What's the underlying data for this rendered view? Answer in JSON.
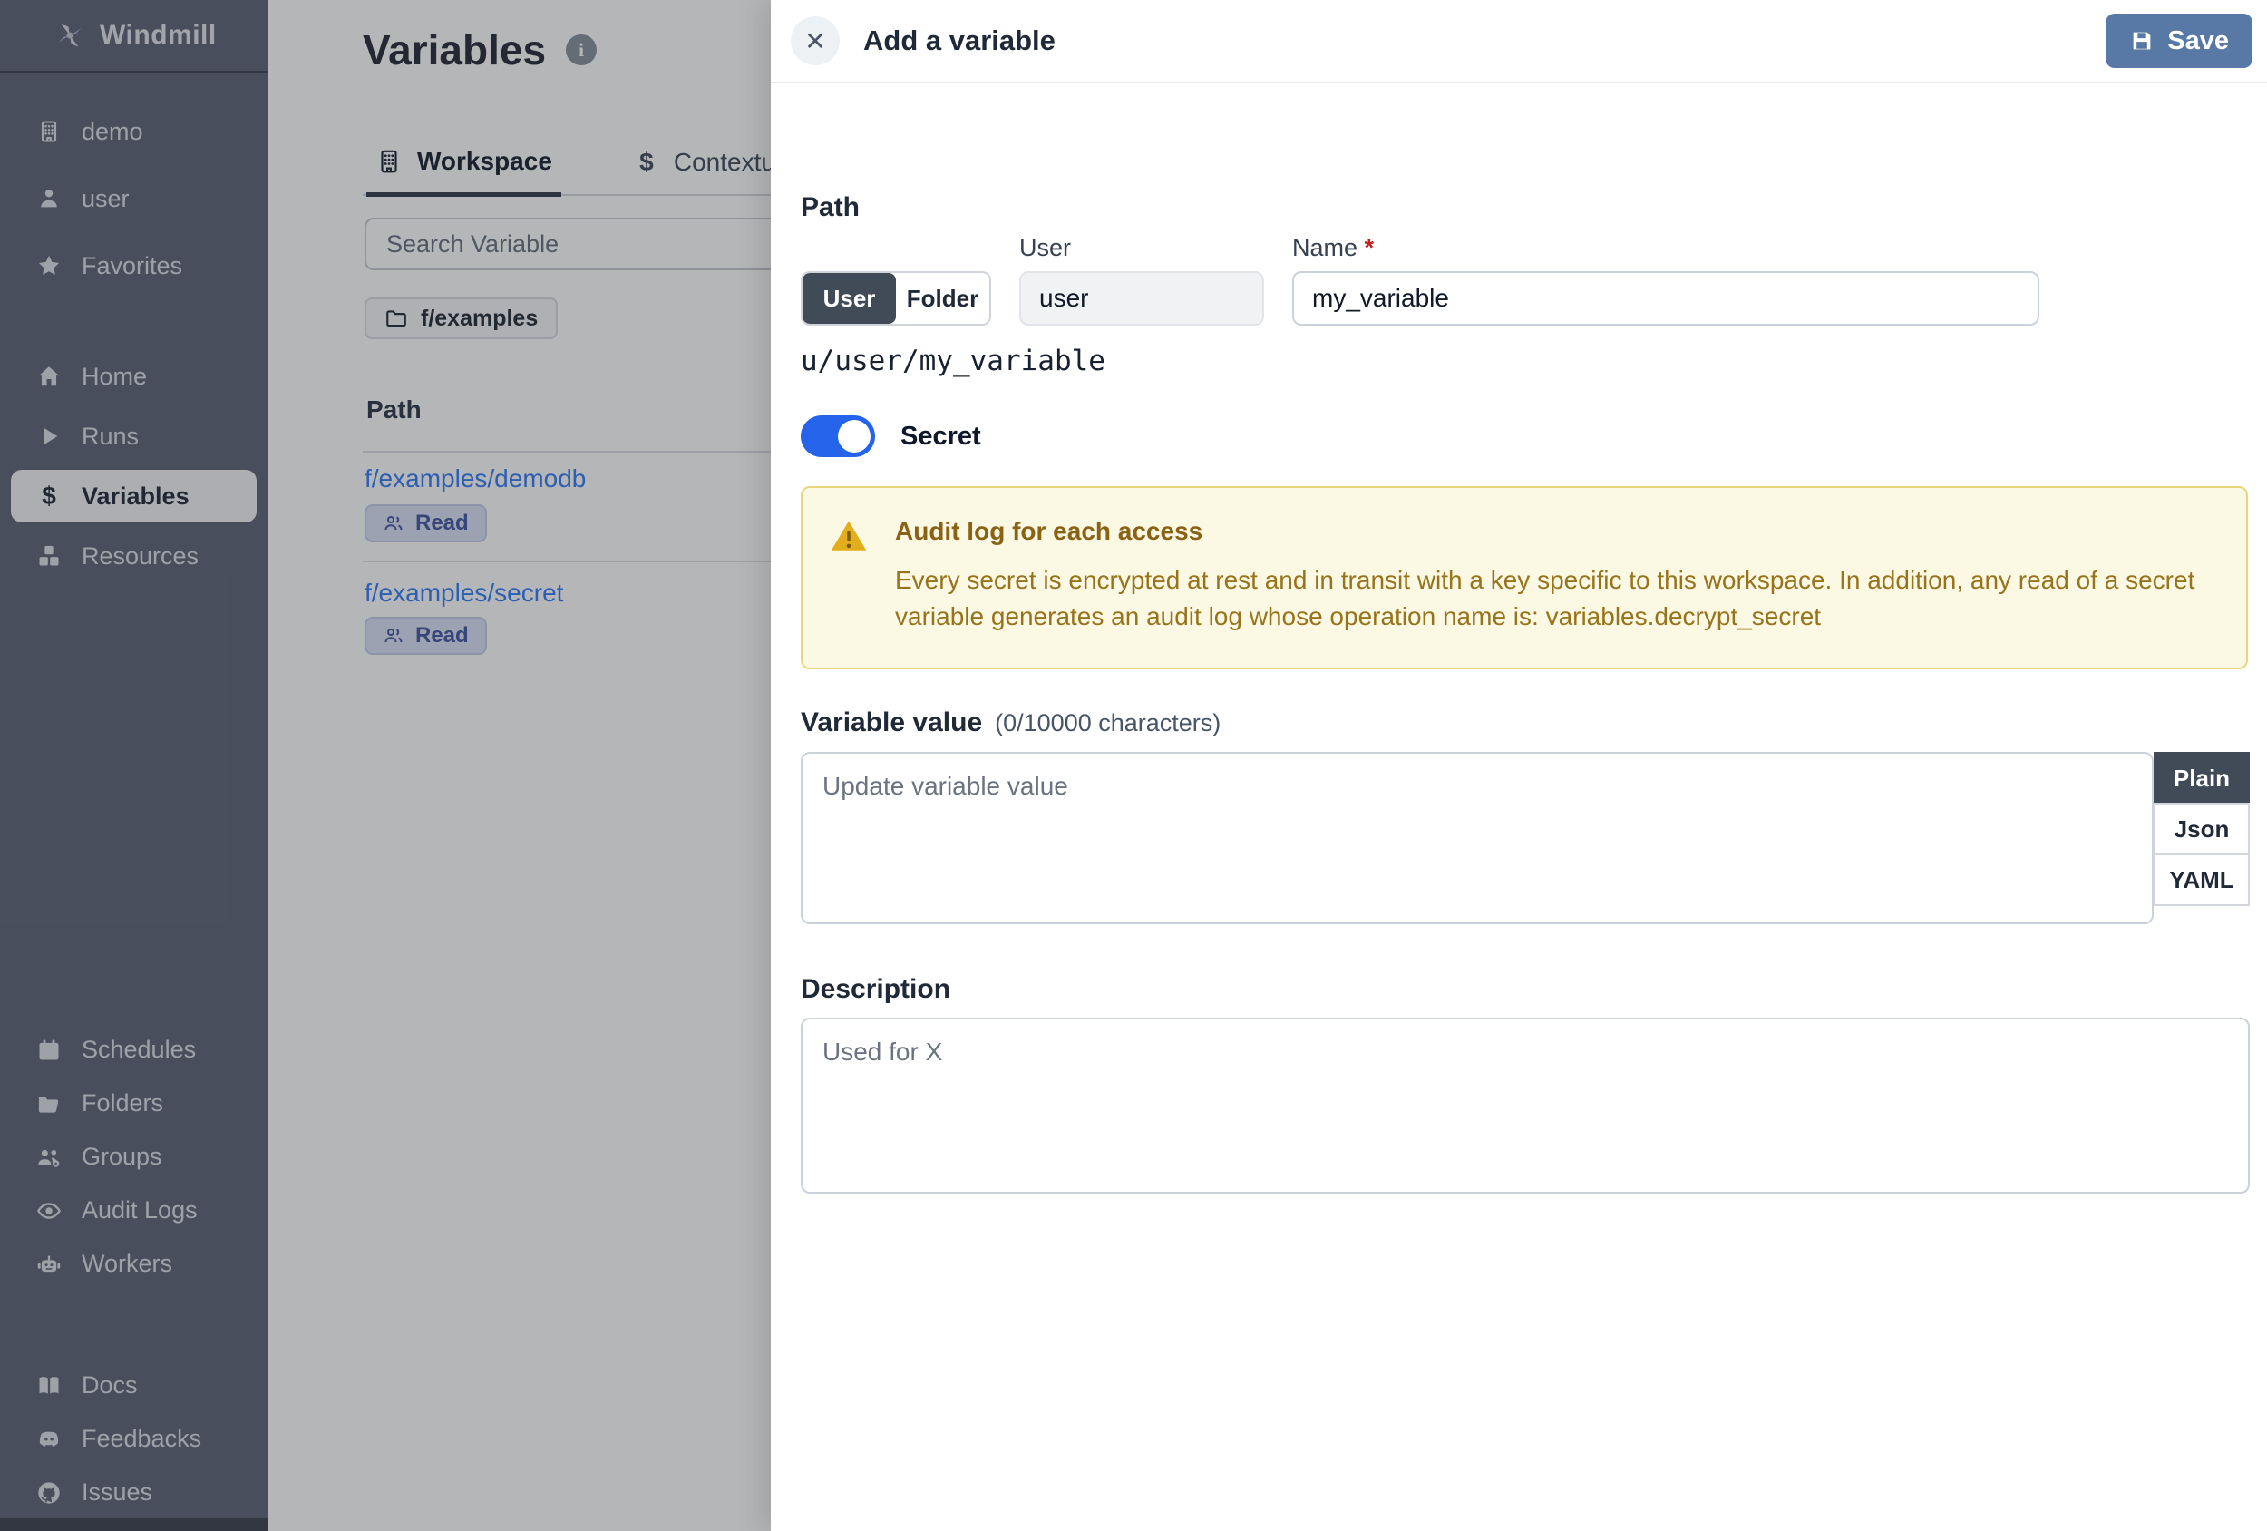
{
  "app": {
    "name": "Windmill"
  },
  "colors": {
    "sidebar_bg": "#646b7c",
    "accent_blue": "#2563eb",
    "save_button_blue": "#5878a5",
    "link_blue": "#3b82f6",
    "warning_bg": "#fbf8e3",
    "warning_border": "#e9d67c",
    "warning_text": "#8a6215",
    "badge_bg": "#dbe3f6",
    "badge_text": "#4a5fa5",
    "selected_segment": "#414a57"
  },
  "sidebar": {
    "workspace_items": [
      {
        "label": "demo",
        "icon": "building-icon"
      },
      {
        "label": "user",
        "icon": "person-icon"
      },
      {
        "label": "Favorites",
        "icon": "star-icon"
      }
    ],
    "nav_items": [
      {
        "label": "Home",
        "icon": "home-icon"
      },
      {
        "label": "Runs",
        "icon": "play-icon"
      },
      {
        "label": "Variables",
        "icon": "dollar-icon",
        "active": true
      },
      {
        "label": "Resources",
        "icon": "cubes-icon"
      }
    ],
    "admin_items": [
      {
        "label": "Schedules",
        "icon": "calendar-icon"
      },
      {
        "label": "Folders",
        "icon": "folder-icon"
      },
      {
        "label": "Groups",
        "icon": "users-gear-icon"
      },
      {
        "label": "Audit Logs",
        "icon": "eye-icon"
      },
      {
        "label": "Workers",
        "icon": "robot-icon"
      }
    ],
    "footer_items": [
      {
        "label": "Docs",
        "icon": "book-icon"
      },
      {
        "label": "Feedbacks",
        "icon": "discord-icon"
      },
      {
        "label": "Issues",
        "icon": "github-icon"
      }
    ]
  },
  "main": {
    "title": "Variables",
    "tabs": [
      {
        "label": "Workspace",
        "active": true
      },
      {
        "label": "Contextual",
        "active": false
      }
    ],
    "search_placeholder": "Search Variable",
    "folder_chip": "f/examples",
    "table": {
      "column_header": "Path",
      "rows": [
        {
          "path": "f/examples/demodb",
          "badge": "Read"
        },
        {
          "path": "f/examples/secret",
          "badge": "Read"
        }
      ]
    }
  },
  "drawer": {
    "title": "Add a variable",
    "save_label": "Save",
    "path_section": {
      "heading": "Path",
      "owner_toggle": {
        "options": [
          "User",
          "Folder"
        ],
        "selected": "User"
      },
      "user_label": "User",
      "user_value": "user",
      "name_label": "Name",
      "name_required_mark": "*",
      "name_value": "my_variable",
      "full_path_preview": "u/user/my_variable"
    },
    "secret_toggle": {
      "label": "Secret",
      "on": true
    },
    "warning": {
      "title": "Audit log for each access",
      "body": "Every secret is encrypted at rest and in transit with a key specific to this workspace. In addition, any read of a secret variable generates an audit log whose operation name is: variables.decrypt_secret"
    },
    "value_section": {
      "heading": "Variable value",
      "counter": "(0/10000 characters)",
      "placeholder": "Update variable value",
      "format_tabs": [
        {
          "label": "Plain",
          "active": true
        },
        {
          "label": "Json",
          "active": false
        },
        {
          "label": "YAML",
          "active": false
        }
      ]
    },
    "description_section": {
      "heading": "Description",
      "placeholder": "Used for X"
    }
  }
}
